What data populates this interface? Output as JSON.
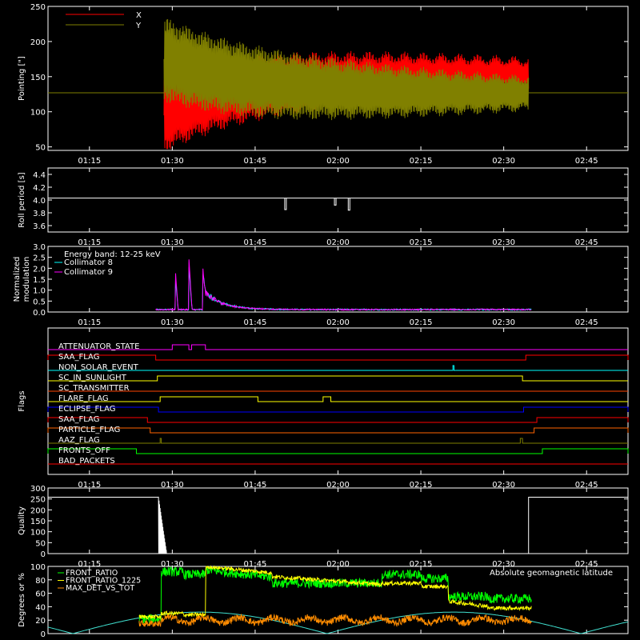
{
  "time_labels": [
    "01:15",
    "01:30",
    "01:45",
    "02:00",
    "02:15",
    "02:30",
    "02:45"
  ],
  "time_range_min": [
    67.5,
    172.5
  ],
  "chart_data": [
    {
      "type": "line",
      "id": "pointing",
      "ylabel": "Pointing [\"]",
      "ylim": [
        45,
        250
      ],
      "yticks": [
        50,
        100,
        150,
        200,
        250
      ],
      "series": [
        {
          "name": "X",
          "color": "#ff0000"
        },
        {
          "name": "Y",
          "color": "#808000"
        }
      ],
      "baseline": 127,
      "data_window_min": [
        88.5,
        154.5
      ]
    },
    {
      "type": "line",
      "id": "roll",
      "ylabel": "Roll period [s]",
      "ylim": [
        3.5,
        4.5
      ],
      "yticks": [
        3.6,
        3.8,
        4.0,
        4.2,
        4.4
      ],
      "baseline": 4.03,
      "dips": [
        {
          "t": 110.5,
          "v": 3.85
        },
        {
          "t": 119.5,
          "v": 3.92
        },
        {
          "t": 122.0,
          "v": 3.84
        }
      ]
    },
    {
      "type": "line",
      "id": "modulation",
      "ylabel": "Normalized\nmodulation",
      "ylim": [
        0,
        3.0
      ],
      "yticks": [
        0.0,
        0.5,
        1.0,
        1.5,
        2.0,
        2.5,
        3.0
      ],
      "annotation": "Energy band: 12-25 keV",
      "series": [
        {
          "name": "Collimator 8",
          "color": "#00ffff"
        },
        {
          "name": "Collimator 9",
          "color": "#ff00ff"
        }
      ],
      "peaks": [
        {
          "t": 90.5,
          "v": 2.1
        },
        {
          "t": 93.0,
          "v": 2.5
        },
        {
          "t": 95.5,
          "v": 1.1
        }
      ]
    },
    {
      "type": "line",
      "id": "flags",
      "ylabel": "Flags",
      "flags": [
        {
          "name": "ATTENUATOR_STATE",
          "color": "#ff00ff",
          "on": [
            [
              90.0,
              93.0
            ],
            [
              93.5,
              96.0
            ]
          ]
        },
        {
          "name": "SAA_FLAG",
          "color": "#ff0000",
          "on": [
            [
              67.5,
              87.0
            ],
            [
              154.0,
              172.5
            ]
          ]
        },
        {
          "name": "NON_SOLAR_EVENT",
          "color": "#00ffff",
          "on": [
            [
              140.8,
              141.0
            ]
          ]
        },
        {
          "name": "SC_IN_SUNLIGHT",
          "color": "#ffff00",
          "on": [
            [
              87.3,
              153.4
            ]
          ]
        },
        {
          "name": "SC_TRANSMITTER",
          "color": "#ff4500",
          "on": []
        },
        {
          "name": "FLARE_FLAG",
          "color": "#ffff00",
          "on": [
            [
              87.8,
              105.5
            ],
            [
              117.3,
              118.7
            ]
          ]
        },
        {
          "name": "ECLIPSE_FLAG",
          "color": "#0000ff",
          "on": [
            [
              67.5,
              87.5
            ],
            [
              153.6,
              172.5
            ]
          ]
        },
        {
          "name": "SAA_FLAG",
          "color": "#ff0000",
          "on": [
            [
              67.5,
              85.5
            ],
            [
              156.0,
              172.5
            ]
          ]
        },
        {
          "name": "PARTICLE_FLAG",
          "color": "#ff6400",
          "on": [
            [
              67.5,
              86.0
            ],
            [
              155.5,
              172.5
            ]
          ]
        },
        {
          "name": "AAZ_FLAG",
          "color": "#808000",
          "on": [
            [
              87.8,
              88.0
            ],
            [
              153.0,
              153.4
            ]
          ]
        },
        {
          "name": "FRONTS_OFF",
          "color": "#00ff00",
          "on": [
            [
              67.5,
              83.5
            ],
            [
              157.0,
              172.5
            ]
          ]
        },
        {
          "name": "BAD_PACKETS",
          "color": "#ff0000",
          "on": []
        }
      ]
    },
    {
      "type": "line",
      "id": "quality",
      "ylabel": "Quality",
      "ylim": [
        0,
        300
      ],
      "yticks": [
        0,
        50,
        100,
        150,
        200,
        250,
        300
      ],
      "high": 258,
      "high_windows": [
        [
          67.5,
          87.5
        ],
        [
          154.5,
          172.5
        ]
      ]
    },
    {
      "type": "line",
      "id": "ratios",
      "ylabel": "Degrees or %",
      "ylim": [
        0,
        100
      ],
      "yticks": [
        0,
        20,
        40,
        60,
        80,
        100
      ],
      "series": [
        {
          "name": "FRONT_RATIO",
          "color": "#00ff00"
        },
        {
          "name": "FRONT_RATIO_1225",
          "color": "#ffff00"
        },
        {
          "name": "MAX_DET_VS_TOT",
          "color": "#ff8c00"
        },
        {
          "name": "Absolute geomagnetic latitude",
          "color": "#40e0d0"
        }
      ]
    }
  ]
}
